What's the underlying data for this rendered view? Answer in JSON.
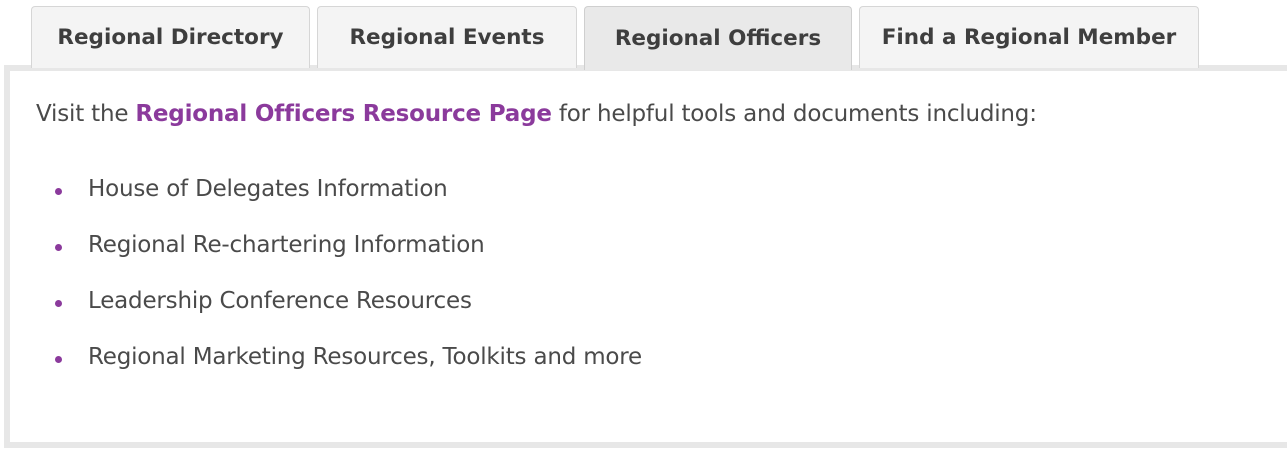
{
  "tabs": [
    {
      "label": "Regional Directory",
      "active": false
    },
    {
      "label": "Regional Events",
      "active": false
    },
    {
      "label": "Regional Officers",
      "active": true
    },
    {
      "label": "Find a Regional Member",
      "active": false
    }
  ],
  "panel": {
    "intro_prefix": "Visit the ",
    "intro_link": "Regional Officers Resource Page",
    "intro_suffix": " for helpful tools and documents including:",
    "items": [
      "House of Delegates Information",
      "Regional Re-chartering Information",
      "Leadership Conference Resources",
      "Regional Marketing Resources, Toolkits and more"
    ]
  },
  "colors": {
    "link": "#8b3a9c",
    "bullet": "#8b3a9c",
    "text": "#4a4a4a",
    "tab_bg": "#f4f4f4",
    "tab_active_bg": "#e9e9e9",
    "panel_border": "#e7e7e7"
  }
}
